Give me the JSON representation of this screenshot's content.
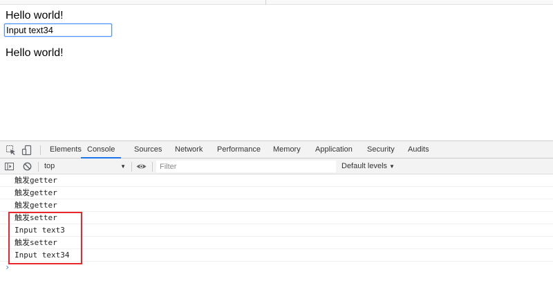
{
  "page": {
    "heading_top": "Hello world!",
    "input_value": "Input text34",
    "heading_bottom": "Hello world!"
  },
  "devtools": {
    "tabs": [
      "Elements",
      "Console",
      "Sources",
      "Network",
      "Performance",
      "Memory",
      "Application",
      "Security",
      "Audits"
    ],
    "active_tab": "Console",
    "toolbar": {
      "context": "top",
      "filter_placeholder": "Filter",
      "levels_label": "Default levels"
    },
    "messages": [
      "触发getter",
      "触发getter",
      "触发getter",
      "触发setter",
      "Input text3",
      "触发setter",
      "Input text34"
    ],
    "prompt_symbol": "›",
    "accent_color": "#1a73e8",
    "highlight_color": "#e8262c"
  }
}
